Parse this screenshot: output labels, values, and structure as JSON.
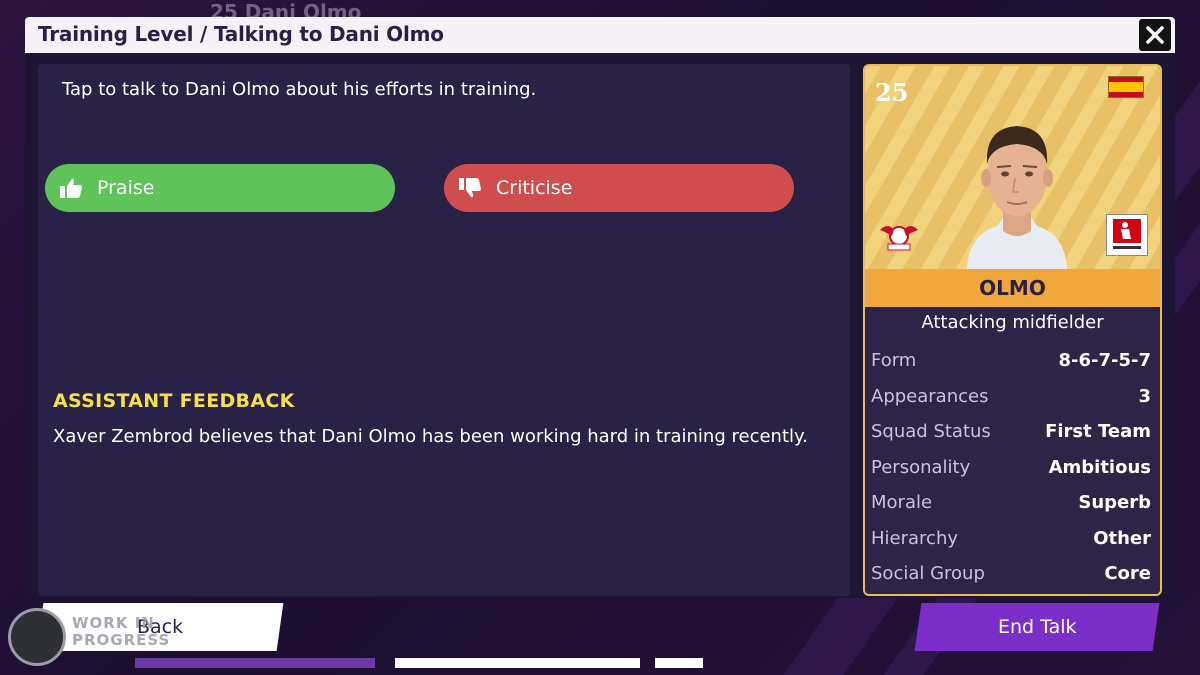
{
  "background": {
    "header_ghost": "25  Dani Olmo"
  },
  "modal": {
    "title": "Training Level / Talking to Dani Olmo",
    "prompt": "Tap to talk to Dani Olmo about his efforts in training.",
    "praise_label": "Praise",
    "criticise_label": "Criticise",
    "feedback_heading": "ASSISTANT FEEDBACK",
    "feedback_text": "Xaver Zembrod believes that Dani Olmo has been working hard in training recently."
  },
  "player_card": {
    "number": "25",
    "surname": "OLMO",
    "position": "Attacking midfielder",
    "nationality_flag": "spain-flag-icon",
    "club_badge": "rb-leipzig-badge-icon",
    "league_badge": "bundesliga-badge-icon",
    "stats": [
      {
        "label": "Form",
        "value": "8-6-7-5-7"
      },
      {
        "label": "Appearances",
        "value": "3"
      },
      {
        "label": "Squad Status",
        "value": "First Team"
      },
      {
        "label": "Personality",
        "value": "Ambitious"
      },
      {
        "label": "Morale",
        "value": "Superb"
      },
      {
        "label": "Hierarchy",
        "value": "Other"
      },
      {
        "label": "Social Group",
        "value": "Core"
      }
    ]
  },
  "footer": {
    "back_label": "Back",
    "end_label": "End Talk",
    "watermark_line1": "WORK IN",
    "watermark_line2": "PROGRESS"
  },
  "colors": {
    "praise": "#5fc35a",
    "criticise": "#cf4d4c",
    "accent": "#7b2fc8",
    "feedback_heading": "#f3e14b",
    "card_gold": "#f0a73c"
  }
}
